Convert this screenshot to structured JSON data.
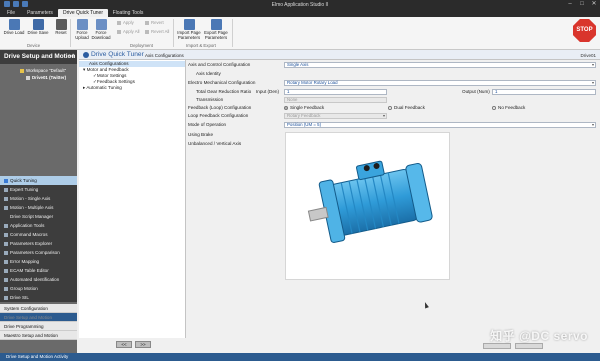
{
  "window": {
    "title": "Elmo Application Studio II"
  },
  "ribbon_tabs": [
    "File",
    "Parameters",
    "Drive Quick Tuner",
    "Floating Tools"
  ],
  "ribbon": {
    "device_group": {
      "label": "Device",
      "buttons": [
        "Drive Load",
        "Drive Save",
        "Reset"
      ]
    },
    "deployment_group": {
      "label": "Deployment",
      "buttons": [
        "Force Upload",
        "Force Download"
      ],
      "small": [
        "Apply",
        "Revert",
        "Apply All",
        "Revert All"
      ]
    },
    "import_export_group": {
      "label": "Import & Export",
      "buttons": [
        "Import Page Parameters",
        "Export Page Parameters"
      ]
    },
    "stop_label": "STOP"
  },
  "left_nav": {
    "header": "Drive Setup and Motion",
    "tree": [
      "Workspace \"Default\"",
      "Drive01 (Twitter)"
    ],
    "items": [
      "Quick Tuning",
      "Expert Tuning",
      "Motion - Single Axis",
      "Motion - Multiple Axis",
      "Drive Script Manager",
      "Application Tools",
      "Command Macros",
      "Parameters Explorer",
      "Parameters Comparison",
      "Error Mapping",
      "ECAM Table Editor",
      "Automated Identification",
      "Group Motion",
      "Drive SIL"
    ],
    "active_index": 0,
    "bottom": [
      "System Configuration",
      "Drive Setup and Motion",
      "Drive Programming",
      "Maestro Setup and Motion"
    ]
  },
  "content_header": {
    "title": "Drive Quick Tuner",
    "subtitle": "Axis Configurations",
    "device": "Drive01"
  },
  "config_tree": [
    "Axis Configurations",
    "Motor and Feedback",
    "Motor Settings",
    "Feedback Settings",
    "Automatic Tuning"
  ],
  "form": {
    "axis_control_label": "Axis and Control Configuration",
    "axis_control_value": "Single Axis",
    "axis_identity_label": "Axis Identity",
    "electro_mech_label": "Electro Mechanical Configuration",
    "electro_mech_value": "Rotary Motor Rotary Load",
    "gear_ratio_label": "Total Gear Reduction Ratio",
    "input_label": "Input (Den)",
    "input_value": "1",
    "output_label": "Output (Num)",
    "output_value": "1",
    "transmission_label": "Transmission",
    "transmission_value": "None",
    "feedback_loop_label": "Feedback (Loop) Configuration",
    "feedback_options": [
      "Single Feedback",
      "Dual Feedback",
      "No Feedback"
    ],
    "loop_feedback_label": "Loop Feedback Configuration",
    "loop_feedback_value": "Rotary Feedback",
    "mode_label": "Mode of Operation",
    "mode_value": "Position (UM = 5)",
    "using_brake_label": "Using Brake",
    "unbalanced_label": "Unbalanced / Vertical Axis"
  },
  "pager": {
    "prev": "<<",
    "next": ">>"
  },
  "status_bar": "Drive Setup and Motion Activity",
  "watermark": "知乎 @DC servo",
  "colors": {
    "accent": "#2c5b8f",
    "stop": "#d9352c",
    "active_nav": "#aecde8"
  }
}
